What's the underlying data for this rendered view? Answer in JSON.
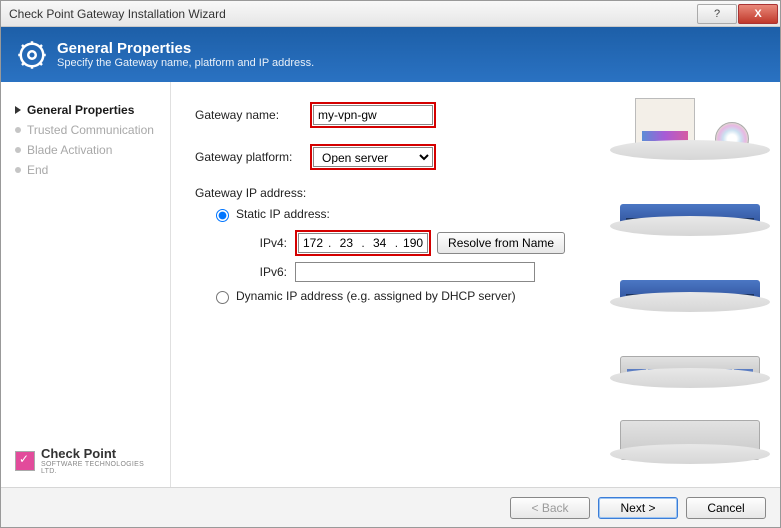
{
  "window": {
    "title": "Check Point Gateway Installation Wizard"
  },
  "banner": {
    "title": "General Properties",
    "subtitle": "Specify the Gateway name, platform and IP address."
  },
  "sidebar": {
    "steps": [
      {
        "label": "General Properties",
        "active": true
      },
      {
        "label": "Trusted Communication",
        "active": false
      },
      {
        "label": "Blade Activation",
        "active": false
      },
      {
        "label": "End",
        "active": false
      }
    ],
    "brand": "Check Point",
    "tagline": "SOFTWARE TECHNOLOGIES LTD."
  },
  "form": {
    "gateway_name_label": "Gateway name:",
    "gateway_name_value": "my-vpn-gw",
    "gateway_platform_label": "Gateway platform:",
    "gateway_platform_value": "Open server",
    "gateway_ip_label": "Gateway IP address:",
    "static_ip_label": "Static IP address:",
    "ipv4_label": "IPv4:",
    "ipv4": {
      "a": "172",
      "b": "23",
      "c": "34",
      "d": "190"
    },
    "ipv6_label": "IPv6:",
    "ipv6_value": "",
    "resolve_btn": "Resolve from Name",
    "dynamic_ip_label": "Dynamic IP address (e.g. assigned by DHCP server)",
    "ip_mode": "static"
  },
  "footer": {
    "back": "< Back",
    "next": "Next >",
    "cancel": "Cancel"
  }
}
